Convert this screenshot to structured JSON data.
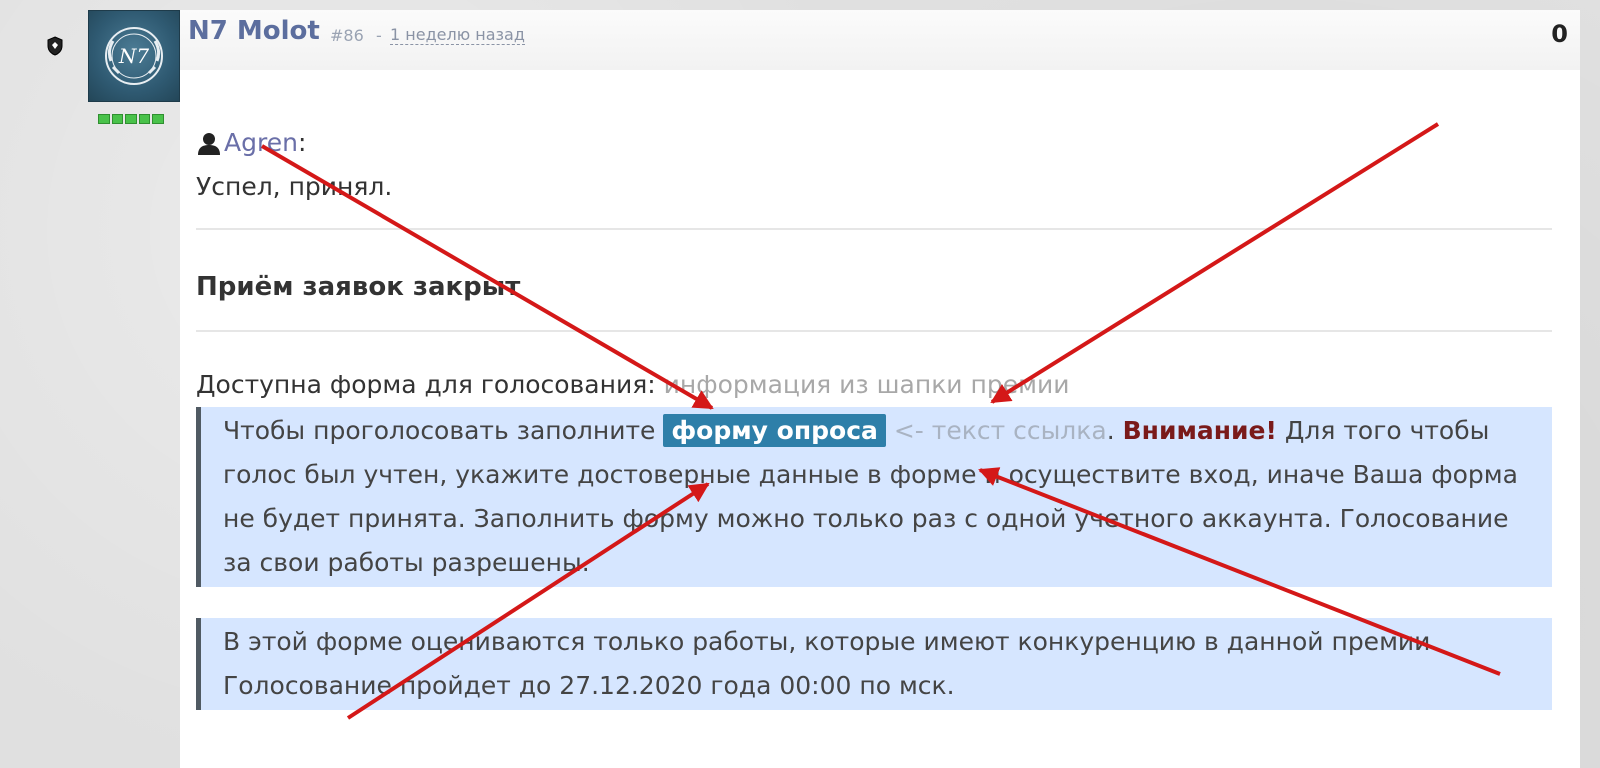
{
  "post": {
    "author": "N7 Molot",
    "number": "#86",
    "separator": "-",
    "time": "1 неделю назад",
    "score": "0"
  },
  "quote": {
    "author": "Agren",
    "colon": ":",
    "text": "Успел, принял."
  },
  "content": {
    "heading": "Приём заявок закрыт",
    "vote_label": "Доступна форма для голосования:",
    "vote_note": "информация из шапки премии",
    "block1": {
      "before_link": "Чтобы проголосовать заполните",
      "link_label": "форму опроса",
      "hint": "<- текст ссылка",
      "dot": ".",
      "warning": "Внимание!",
      "rest": "Для того чтобы голос был учтен, укажите достоверные данные в форме и осуществите вход, иначе Ваша форма не будет принята. Заполнить форму можно только раз с одной учетного аккаунта. Голосование за свои работы разрешены."
    },
    "block2": {
      "text": "В этой форме оцениваются только работы, которые имеют конкуренцию в данной премии. Голосование пройдет до 27.12.2020 года 00:00 по мск."
    }
  },
  "icons": {
    "shield": "shield-icon",
    "avatar": "avatar-emblem",
    "user": "user-icon"
  },
  "colors": {
    "author": "#5c6e9e",
    "link_badge": "#2e7fa9",
    "block_bg": "#d6e6ff",
    "warning": "#7a1a1a",
    "arrow": "#d41818",
    "rank": "#49c24a"
  }
}
